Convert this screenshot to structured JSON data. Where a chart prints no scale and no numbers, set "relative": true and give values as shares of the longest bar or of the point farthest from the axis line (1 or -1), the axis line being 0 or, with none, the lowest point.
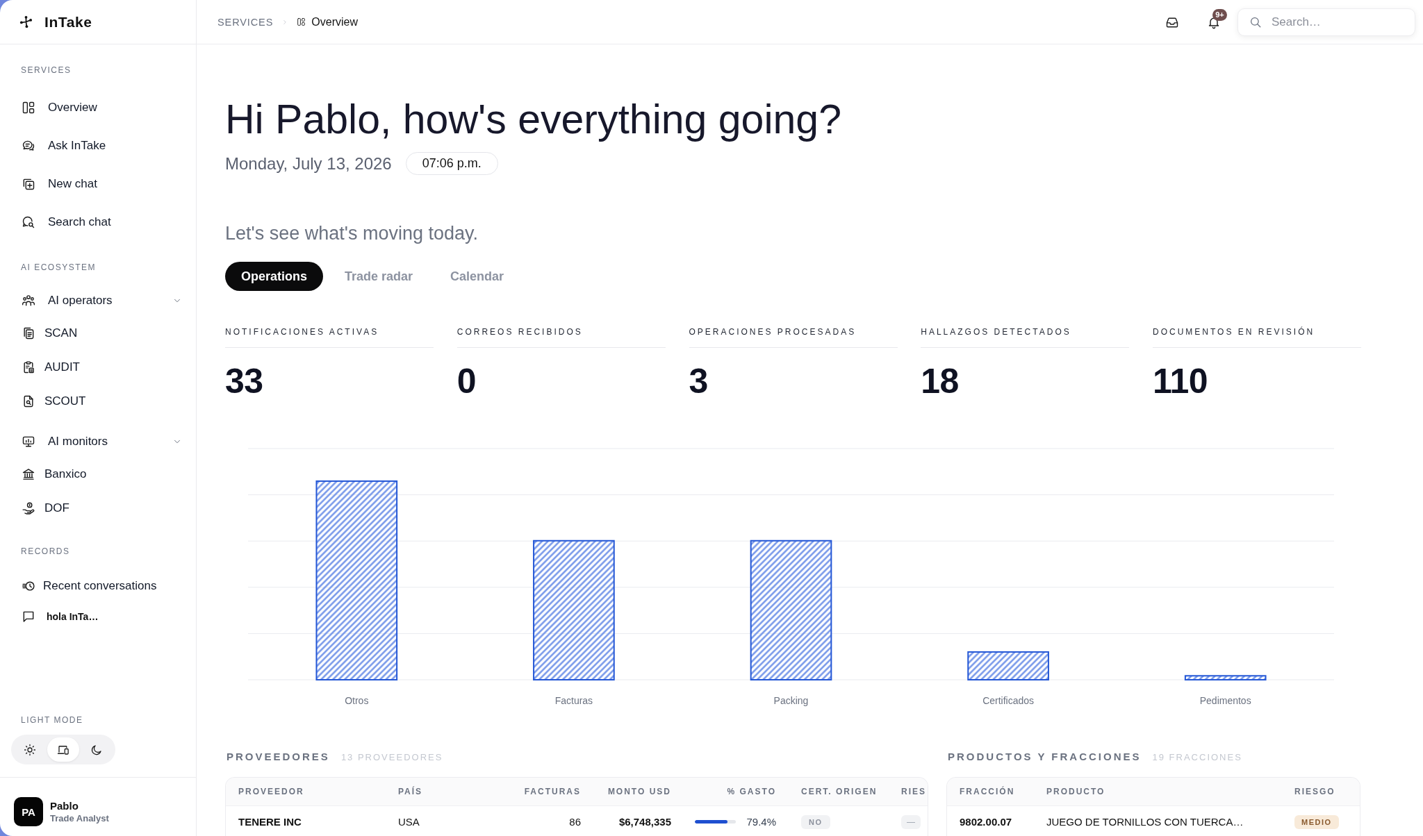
{
  "sidebar": {
    "brand": "InTake",
    "sections": [
      {
        "title": "SERVICES",
        "items": [
          {
            "kind": "link",
            "label": "Overview"
          },
          {
            "kind": "link",
            "label": "Ask InTake"
          },
          {
            "kind": "link",
            "label": "New chat"
          },
          {
            "kind": "link",
            "label": "Search chat"
          }
        ]
      },
      {
        "title": "AI ECOSYSTEM",
        "items": [
          {
            "kind": "group",
            "label": "AI operators",
            "expanded": true,
            "children": [
              {
                "label": "SCAN"
              },
              {
                "label": "AUDIT"
              },
              {
                "label": "SCOUT"
              }
            ]
          },
          {
            "kind": "group",
            "label": "AI monitors",
            "expanded": true,
            "children": [
              {
                "label": "Banxico"
              },
              {
                "label": "DOF"
              }
            ]
          }
        ]
      },
      {
        "title": "RECORDS",
        "items": [
          {
            "kind": "link",
            "label": "Recent conversations"
          },
          {
            "kind": "conversation",
            "label": "hola InTa…"
          }
        ]
      }
    ],
    "theme": {
      "title": "LIGHT MODE",
      "options": [
        {
          "selected": false
        },
        {
          "selected": true
        },
        {
          "selected": false
        }
      ]
    },
    "user": {
      "initials": "PA",
      "name": "Pablo",
      "role": "Trade Analyst"
    }
  },
  "header": {
    "breadcrumb": [
      {
        "label": "SERVICES"
      },
      {
        "label": "Overview"
      }
    ],
    "notifications_badge": "9+",
    "search": {
      "placeholder": "Search…"
    }
  },
  "main": {
    "greeting": "Hi Pablo, how's everything going?",
    "date": "Monday, July 13, 2026",
    "time": "07:06 p.m.",
    "subtitle": "Let's see what's moving today.",
    "tabs": [
      {
        "label": "Operations",
        "selected": true
      },
      {
        "label": "Trade radar",
        "selected": false
      },
      {
        "label": "Calendar",
        "selected": false
      }
    ],
    "stats": [
      {
        "label": "NOTIFICACIONES ACTIVAS",
        "value": "33"
      },
      {
        "label": "CORREOS RECIBIDOS",
        "value": "0"
      },
      {
        "label": "OPERACIONES PROCESADAS",
        "value": "3"
      },
      {
        "label": "HALLAZGOS DETECTADOS",
        "value": "18"
      },
      {
        "label": "DOCUMENTOS EN REVISIÓN",
        "value": "110"
      }
    ],
    "chart_data": {
      "type": "bar",
      "relative": true,
      "categories": [
        "Otros",
        "Facturas",
        "Packing",
        "Certificados",
        "Pedimentos"
      ],
      "values": [
        1,
        0.7,
        0.7,
        0.14,
        0.02
      ]
    },
    "suppliers": {
      "title": "PROVEEDORES",
      "count": "13 PROVEEDORES",
      "columns": [
        "PROVEEDOR",
        "PAÍS",
        "FACTURAS",
        "MONTO USD",
        "% GASTO",
        "CERT. ORIGEN",
        "RIES"
      ],
      "rows": [
        {
          "proveedor": "TENERE INC",
          "pais": "USA",
          "facturas": "86",
          "monto_usd": "$6,748,335",
          "gasto": {
            "level": 0.794,
            "reading": "79.4%"
          },
          "cert_origen": "NO",
          "column_7": "—"
        }
      ]
    },
    "products": {
      "title": "PRODUCTOS Y FRACCIONES",
      "count": "19 FRACCIONES",
      "columns": [
        "FRACCIÓN",
        "PRODUCTO",
        "RIESGO"
      ],
      "rows": [
        {
          "fraccion": "9802.00.07",
          "producto": "JUEGO DE TORNILLOS CON TUERCA…",
          "riesgo": "MEDIO"
        }
      ]
    }
  }
}
